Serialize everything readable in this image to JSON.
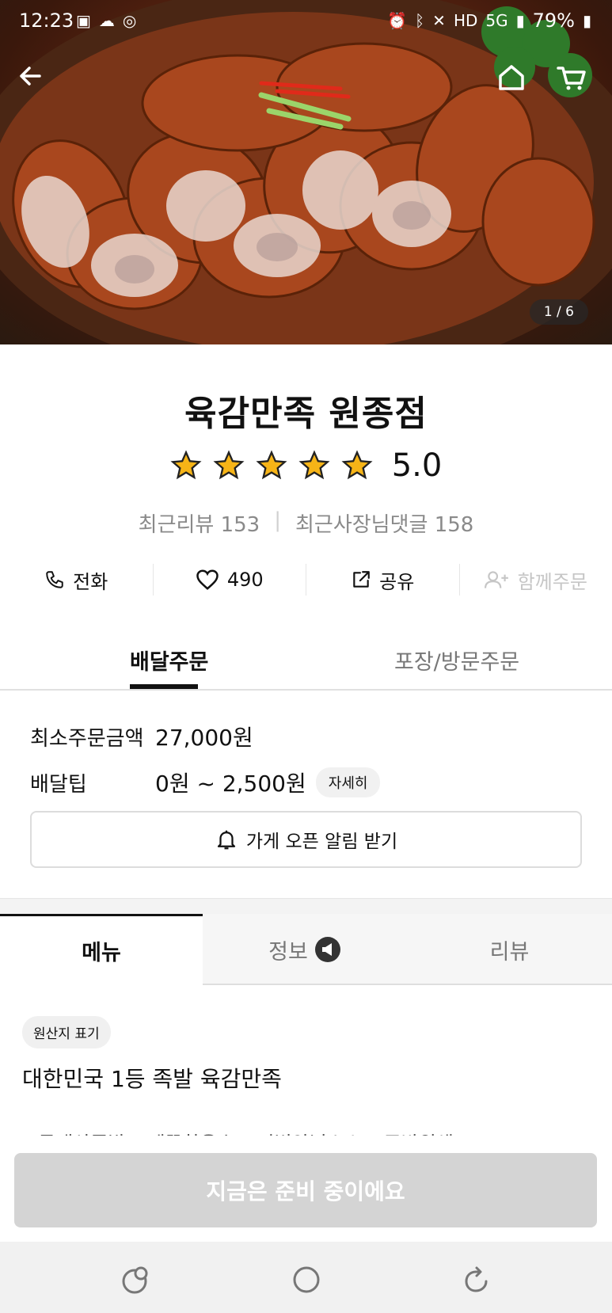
{
  "status_bar": {
    "time": "12:23",
    "battery": "79%",
    "network": "5G",
    "hd_label": "HD"
  },
  "hero": {
    "counter": "1 / 6",
    "icons": [
      "back-arrow-icon",
      "home-icon",
      "cart-icon"
    ]
  },
  "store": {
    "name": "육감만족 원종점",
    "rating": 5.0,
    "rating_text": "5.0",
    "stars": 5,
    "recent_reviews": "최근리뷰 153",
    "owner_replies": "최근사장님댓글 158"
  },
  "actions": {
    "call": "전화",
    "likes": "490",
    "share": "공유",
    "group_order": "함께주문"
  },
  "order_tabs": {
    "delivery": "배달주문",
    "pickup": "포장/방문주문"
  },
  "delivery_info": {
    "min_order_label": "최소주문금액",
    "min_order_value": "27,000원",
    "tip_label": "배달팁",
    "tip_value": "0원 ~ 2,500원",
    "detail_chip": "자세히",
    "notify_button": "가게 오픈 알림 받기"
  },
  "content_tabs": {
    "menu": "메뉴",
    "info": "정보",
    "review": "리뷰"
  },
  "menu_section": {
    "origin_chip": "원산지 표기",
    "headline": "대한민국 1등 족발 육감만족",
    "cut_text": "✓국내산족발 ✓깨끗한육수 ✓비법양념소스 ✓주방위생"
  },
  "bottom": {
    "status_button": "지금은 준비 중이에요"
  },
  "colors": {
    "accent": "#111111",
    "star": "#F6B417",
    "disabled_button": "#D4D4D4"
  }
}
